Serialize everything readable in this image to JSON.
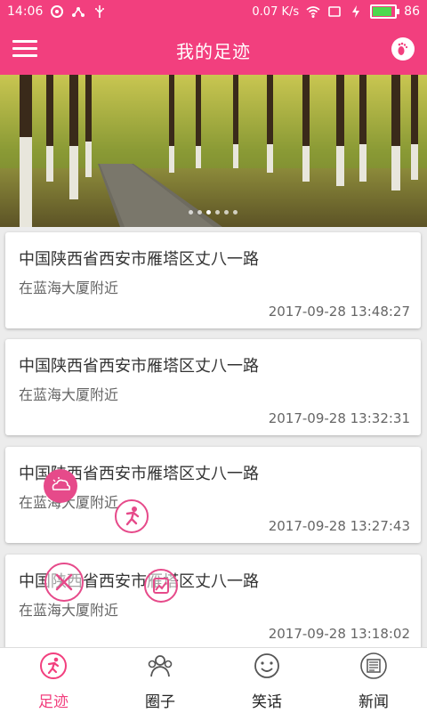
{
  "status_bar": {
    "time": "14:06",
    "speed": "0.07 K/s",
    "battery_level": "86",
    "battery_fill": 0.86
  },
  "app_bar": {
    "title": "我的足迹",
    "menu_icon": "hamburger-menu-icon",
    "action_icon": "footprint-icon"
  },
  "banner": {
    "image": "forest-path-photo",
    "slide_count": 6,
    "active_slide": 2
  },
  "records": [
    {
      "address": "中国陕西省西安市雁塔区丈八一路",
      "nearby": "在蓝海大厦附近",
      "time": "2017-09-28  13:48:27"
    },
    {
      "address": "中国陕西省西安市雁塔区丈八一路",
      "nearby": "在蓝海大厦附近",
      "time": "2017-09-28  13:32:31"
    },
    {
      "address": "中国陕西省西安市雁塔区丈八一路",
      "nearby": "在蓝海大厦附近",
      "time": "2017-09-28  13:27:43"
    },
    {
      "address": "中国陕西省西安市雁塔区丈八一路",
      "nearby": "在蓝海大厦附近",
      "time": "2017-09-28  13:18:02"
    }
  ],
  "fab_menu": {
    "weather_icon": "weather-icon",
    "run_icon": "running-icon",
    "close_icon": "close-icon",
    "chart_icon": "chart-icon"
  },
  "bottom_nav": {
    "items": [
      {
        "label": "足迹",
        "icon": "running-icon",
        "active": true
      },
      {
        "label": "圈子",
        "icon": "group-icon",
        "active": false
      },
      {
        "label": "笑话",
        "icon": "smiley-icon",
        "active": false
      },
      {
        "label": "新闻",
        "icon": "newspaper-icon",
        "active": false
      }
    ]
  },
  "colors": {
    "primary": "#f23f7e",
    "accent": "#e64a8a"
  }
}
